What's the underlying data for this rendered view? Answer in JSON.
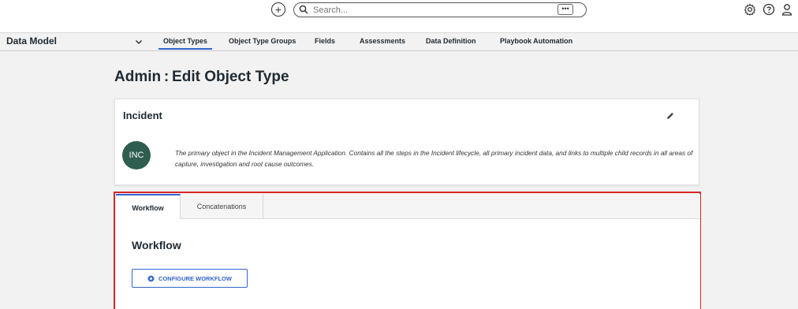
{
  "search": {
    "placeholder": "Search...",
    "more_label": "•••"
  },
  "nav": {
    "title": "Data Model",
    "tabs": [
      {
        "label": "Object Types"
      },
      {
        "label": "Object Type Groups"
      },
      {
        "label": "Fields"
      },
      {
        "label": "Assessments"
      },
      {
        "label": "Data Definition"
      },
      {
        "label": "Playbook Automation"
      }
    ]
  },
  "page": {
    "title": "Admin : Edit Object Type"
  },
  "card": {
    "title": "Incident",
    "avatar": "INC",
    "description": "The primary object in the Incident Management Application. Contains all the steps in the Incident lifecycle, all primary incident data, and links to multiple child records in all areas of capture, investigation and root cause outcomes."
  },
  "detail": {
    "tabs": [
      {
        "label": "Workflow"
      },
      {
        "label": "Concatenations"
      }
    ],
    "section_title": "Workflow",
    "button_label": "CONFIGURE WORKFLOW"
  },
  "colors": {
    "accent": "#3366cc",
    "highlight_border": "#d62828",
    "avatar_bg": "#2f5d50"
  }
}
